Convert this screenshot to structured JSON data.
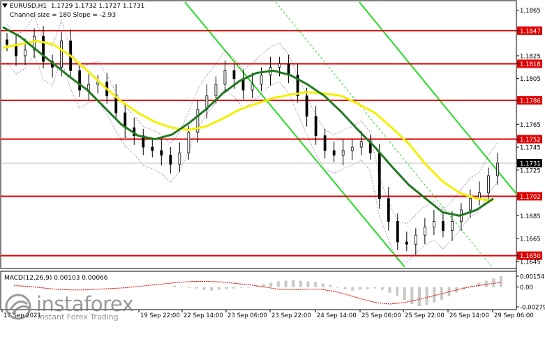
{
  "header": {
    "line1": "EURUSD,H1  1.1729 1.1732 1.1727 1.1731",
    "line2": "Channel size = 180 Slope = -2.93"
  },
  "macd_label": "MACD(12,26,9) 0.00103 0.00066",
  "watermark": {
    "brand": "instaforex",
    "tagline": "Instant Forex Trading"
  },
  "colors": {
    "resistance": "#e00000",
    "price_tag": "#e00000",
    "current_price": "#c0c0c0",
    "ma_fast": "#f5f000",
    "ma_slow": "#1f7a1f",
    "channel": "#22dd22",
    "candles": "#000000",
    "bands": "#b070c0",
    "histogram": "#c8c8c8",
    "signal": "#e00000"
  },
  "chart_data": {
    "type": "candlestick",
    "symbol": "EURUSD",
    "timeframe": "H1",
    "ohlc_last": {
      "open": 1.1729,
      "high": 1.1732,
      "low": 1.1727,
      "close": 1.1731
    },
    "ylim": [
      1.164,
      1.1872
    ],
    "price_axis_ticks": [
      1.1865,
      1.1847,
      1.1825,
      1.1818,
      1.1805,
      1.1786,
      1.1765,
      1.1752,
      1.1745,
      1.1731,
      1.1725,
      1.1702,
      1.1685,
      1.1665,
      1.165,
      1.1645
    ],
    "resistance_levels": [
      1.1847,
      1.1818,
      1.1786,
      1.1752,
      1.1702,
      1.165
    ],
    "current_price": 1.1731,
    "x_tick_labels": [
      "17 Sep 2021",
      "19 Sep 22:00",
      "22 Sep 14:00",
      "23 Sep 06:00",
      "23 Sep 22:00",
      "24 Sep 14:00",
      "25 Sep 06:00",
      "25 Sep 22:00",
      "26 Sep 14:00",
      "29 Sep 06:00"
    ],
    "closes": [
      1.1835,
      1.1825,
      1.183,
      1.1842,
      1.182,
      1.1815,
      1.1838,
      1.1812,
      1.1795,
      1.18,
      1.1802,
      1.179,
      1.1775,
      1.1762,
      1.1755,
      1.1745,
      1.1742,
      1.1738,
      1.173,
      1.174,
      1.1758,
      1.1778,
      1.179,
      1.18,
      1.1812,
      1.1805,
      1.1795,
      1.18,
      1.1808,
      1.1815,
      1.1818,
      1.1808,
      1.179,
      1.1772,
      1.1755,
      1.1742,
      1.1738,
      1.1742,
      1.1745,
      1.175,
      1.174,
      1.17,
      1.168,
      1.1662,
      1.166,
      1.1668,
      1.1675,
      1.168,
      1.1672,
      1.168,
      1.169,
      1.17,
      1.1705,
      1.172,
      1.1731
    ],
    "ma_fast": [
      1.1832,
      1.1835,
      1.1838,
      1.1835,
      1.1825,
      1.1812,
      1.1798,
      1.1785,
      1.1775,
      1.1767,
      1.1762,
      1.176,
      1.1763,
      1.177,
      1.1778,
      1.1783,
      1.1788,
      1.1791,
      1.1793,
      1.1792,
      1.179,
      1.1783,
      1.1775,
      1.1762,
      1.1748,
      1.173,
      1.1715,
      1.1705,
      1.17,
      1.1698
    ],
    "ma_slow": [
      1.185,
      1.1842,
      1.183,
      1.1818,
      1.1806,
      1.1795,
      1.178,
      1.1765,
      1.1755,
      1.1752,
      1.1756,
      1.1766,
      1.1778,
      1.1792,
      1.1803,
      1.181,
      1.1812,
      1.1808,
      1.18,
      1.179,
      1.1776,
      1.176,
      1.1745,
      1.1728,
      1.1712,
      1.17,
      1.1688,
      1.1685,
      1.169,
      1.17
    ],
    "macd_axis": {
      "ticks": [
        0.00154,
        0.0,
        -0.00279
      ],
      "ylim": [
        -0.00279,
        0.00154
      ]
    },
    "macd_histogram": [
      0.0002,
      0.0001,
      -0.0001,
      -0.0002,
      -0.0004,
      -0.0005,
      -0.0004,
      -0.0003,
      -0.0002,
      -0.0001,
      0.0,
      0.0002,
      0.0004,
      0.0006,
      0.0008,
      0.0009,
      0.001,
      0.0009,
      0.0008,
      0.0007,
      0.0005,
      0.0003,
      0.0,
      -0.0003,
      -0.0005,
      -0.0004,
      -0.0003,
      -0.0002,
      -0.0004,
      -0.0008,
      -0.0012,
      -0.0018,
      -0.0024,
      -0.0027,
      -0.0025,
      -0.0022,
      -0.0018,
      -0.0013,
      -0.0008,
      -0.0003,
      0.0002,
      0.0006,
      0.0009,
      0.0012,
      0.00154
    ],
    "macd_signal": [
      0.0002,
      0.0001,
      -0.0001,
      -0.0003,
      -0.0004,
      -0.0004,
      -0.0003,
      -0.0002,
      -0.0001,
      0.0001,
      0.0003,
      0.0005,
      0.0007,
      0.0008,
      0.0008,
      0.0007,
      0.0005,
      0.0003,
      0.0,
      -0.0003,
      -0.0004,
      -0.0003,
      -0.0003,
      -0.0006,
      -0.0011,
      -0.0017,
      -0.0022,
      -0.0024,
      -0.0022,
      -0.0018,
      -0.0013,
      -0.0008,
      -0.0003,
      0.0001,
      0.0004,
      0.00066
    ]
  }
}
